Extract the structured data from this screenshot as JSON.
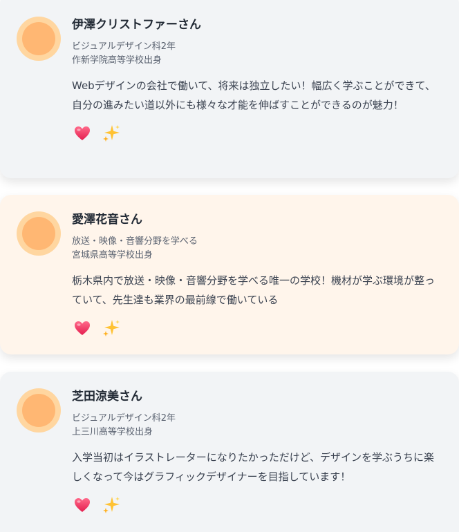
{
  "testimonials": [
    {
      "name": "伊澤クリストファーさん",
      "course": "ビジュアルデザイン科2年",
      "school": "作新学院高等学校出身",
      "comment": "Webデザインの会社で働いて、将来は独立したい！幅広く学ぶことができて、自分の進みたい道以外にも様々な才能を伸ばすことができるのが魅力！",
      "reactions": [
        "heart-icon",
        "sparkles-icon"
      ]
    },
    {
      "name": "愛澤花音さん",
      "course": "放送・映像・音響分野を学べる",
      "school": "宮城県高等学校出身",
      "comment": "栃木県内で放送・映像・音響分野を学べる唯一の学校！機材が学ぶ環境が整っていて、先生達も業界の最前線で働いている",
      "reactions": [
        "heart-icon",
        "sparkles-icon"
      ]
    },
    {
      "name": "芝田涼美さん",
      "course": "ビジュアルデザイン科2年",
      "school": "上三川高等学校出身",
      "comment": "入学当初はイラストレーターになりたかっただけど、デザインを学ぶうちに楽しくなって今はグラフィックデザイナーを目指しています！",
      "reactions": [
        "heart-icon",
        "sparkles-icon"
      ]
    }
  ],
  "colors": {
    "card_gray": "#f2f4f6",
    "card_peach": "#fff5eb",
    "avatar_outer": "#ffd6a0",
    "avatar_inner": "#ffb773",
    "heart": "#f0325a",
    "sparkle": "#ffc233"
  }
}
